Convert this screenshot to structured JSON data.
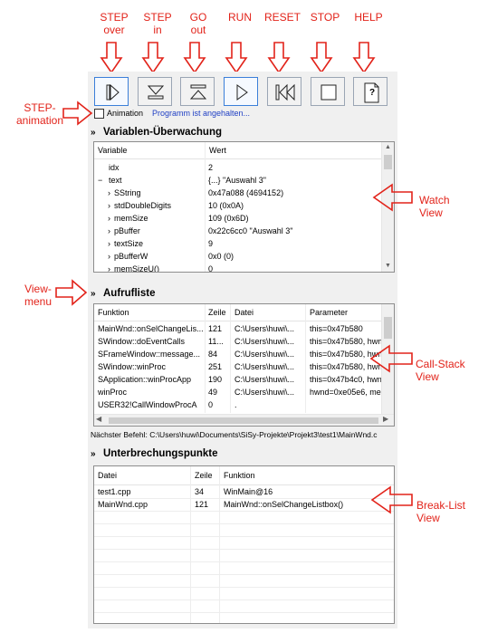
{
  "top_labels": [
    {
      "line1": "STEP",
      "line2": "over"
    },
    {
      "line1": "STEP",
      "line2": "in"
    },
    {
      "line1": "GO",
      "line2": "out"
    },
    {
      "line1": "RUN",
      "line2": ""
    },
    {
      "line1": "RESET",
      "line2": ""
    },
    {
      "line1": "STOP",
      "line2": ""
    },
    {
      "line1": "HELP",
      "line2": ""
    }
  ],
  "side_labels": {
    "step_animation": [
      "STEP-",
      "animation"
    ],
    "watch": [
      "Watch",
      "View"
    ],
    "view_menu": [
      "View-",
      "menu"
    ],
    "call_stack": [
      "Call-Stack",
      "View"
    ],
    "break_list": [
      "Break-List",
      "View"
    ]
  },
  "toolbar": {
    "help_glyph": "?",
    "animation_label": "Animation",
    "status_text": "Programm ist angehalten...",
    "status_color": "#1f3fc4"
  },
  "sections": {
    "chevron": "»",
    "variables": "Variablen-Überwachung",
    "callstack": "Aufrufliste",
    "breakpoints": "Unterbrechungspunkte"
  },
  "watch": {
    "col_variable": "Variable",
    "col_value": "Wert",
    "rows": [
      {
        "name": "idx",
        "value": "2",
        "prefix": ""
      },
      {
        "name": "text",
        "value": "{...} \"Auswahl 3\"",
        "prefix": "−"
      },
      {
        "name": "SString",
        "value": "0x47a088 (4694152)",
        "prefix": "›"
      },
      {
        "name": "stdDoubleDigits",
        "value": "10 (0x0A)",
        "prefix": "›"
      },
      {
        "name": "memSize",
        "value": "109 (0x6D)",
        "prefix": "›"
      },
      {
        "name": "pBuffer",
        "value": "0x22c6cc0 \"Auswahl 3\"",
        "prefix": "›"
      },
      {
        "name": "textSize",
        "value": "9",
        "prefix": "›"
      },
      {
        "name": "pBufferW",
        "value": "0x0 (0)",
        "prefix": "›"
      },
      {
        "name": "memSizeU()",
        "value": "0",
        "prefix": "›"
      }
    ]
  },
  "callstack": {
    "col_function": "Funktion",
    "col_line": "Zeile",
    "col_file": "Datei",
    "col_params": "Parameter",
    "rows": [
      {
        "fn": "MainWnd::onSelChangeLis...",
        "line": "121",
        "file": "C:\\Users\\huwi\\...",
        "params": "this=0x47b580"
      },
      {
        "fn": "SWindow::doEventCalls",
        "line": "11...",
        "file": "C:\\Users\\huwi\\...",
        "params": "this=0x47b580, hwn"
      },
      {
        "fn": "SFrameWindow::message...",
        "line": "84",
        "file": "C:\\Users\\huwi\\...",
        "params": "this=0x47b580, hwn"
      },
      {
        "fn": "SWindow::winProc",
        "line": "251",
        "file": "C:\\Users\\huwi\\...",
        "params": "this=0x47b580, hwn"
      },
      {
        "fn": "SApplication::winProcApp",
        "line": "190",
        "file": "C:\\Users\\huwi\\...",
        "params": "this=0x47b4c0, hwn"
      },
      {
        "fn": "winProc",
        "line": "49",
        "file": "C:\\Users\\huwi\\...",
        "params": "hwnd=0xe05e6, me"
      },
      {
        "fn": "USER32!CallWindowProcA",
        "line": "0",
        "file": ".",
        "params": ""
      }
    ],
    "next_command": "Nächster Befehl: C:\\Users\\huwi\\Documents\\SiSy-Projekte\\Projekt3\\test1\\MainWnd.c"
  },
  "breakpoints": {
    "col_file": "Datei",
    "col_line": "Zeile",
    "col_function": "Funktion",
    "rows": [
      {
        "file": "test1.cpp",
        "line": "34",
        "fn": "WinMain@16"
      },
      {
        "file": "MainWnd.cpp",
        "line": "121",
        "fn": "MainWnd::onSelChangeListbox()"
      }
    ]
  },
  "colors": {
    "annotation_red": "#e2231a",
    "panel_bg": "#f0f0f0",
    "active_border": "#3b7fd9"
  }
}
